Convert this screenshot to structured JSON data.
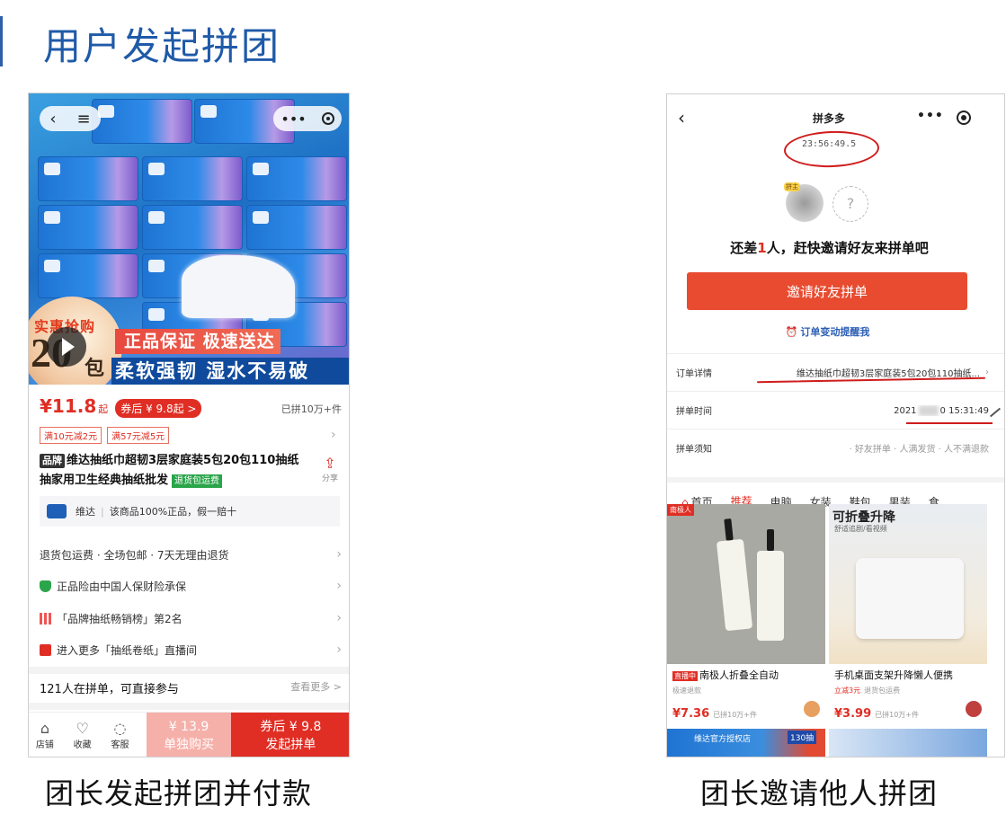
{
  "slide": {
    "title": "用户发起拼团",
    "caption_left": "团长发起拼团并付款",
    "caption_right": "团长邀请他人拼团"
  },
  "left_phone": {
    "image_badge": {
      "top": "实惠抢购",
      "number": "20",
      "unit": "包"
    },
    "banner_red": "正品保证 极速送达",
    "banner_blue": "柔软强韧 湿水不易破",
    "price": "¥11.8",
    "price_suffix": "起",
    "coupon": "券后 ¥ 9.8起 >",
    "sold": "已拼10万+件",
    "discounts": [
      "满10元减2元",
      "满57元减5元"
    ],
    "brand_tag": "品牌",
    "title": "维达抽纸巾超韧3层家庭装5包20包110抽纸抽家用卫生经典抽纸批发",
    "return_tag": "退货包运费",
    "share": "分享",
    "brand_name": "维达",
    "brand_note": "该商品100%正品，假一赔十",
    "services": [
      "退货包运费 · 全场包邮 · 7天无理由退货",
      "正品险由中国人保财险承保",
      "「品牌抽纸畅销榜」第2名",
      "进入更多「抽纸卷纸」直播间"
    ],
    "group_text": "121人在拼单，可直接参与",
    "group_more": "查看更多 >",
    "bottom": {
      "store": "店铺",
      "favorite": "收藏",
      "service": "客服",
      "alone_price": "¥ 13.9",
      "alone_label": "单独购买",
      "group_price": "券后 ¥ 9.8",
      "group_label": "发起拼单"
    }
  },
  "right_phone": {
    "title": "拼多多",
    "timer": "23:56:49.5",
    "leader_tag": "拼主",
    "empty_slot": "?",
    "invite_prefix": "还差",
    "invite_count": "1",
    "invite_suffix": "人，赶快邀请好友来拼单吧",
    "invite_button": "邀请好友拼单",
    "remind": "订单变动提醒我",
    "order_detail_label": "订单详情",
    "order_detail_value": "维达抽纸巾超韧3层家庭装5包20包110抽纸...",
    "order_time_label": "拼单时间",
    "order_time_prefix": "2021",
    "order_time_suffix": "0 15:31:49",
    "notice_label": "拼单须知",
    "notice_value": "· 好友拼单 · 人满发货 · 人不满退款",
    "tabs": [
      "首页",
      "推荐",
      "电脑",
      "女装",
      "鞋包",
      "男装",
      "食"
    ],
    "active_tab": "推荐",
    "products": [
      {
        "corner": "南极人",
        "live_tag": "直播中",
        "name": "南极人折叠全自动",
        "sub": "极速退款",
        "price": "¥7.36",
        "sold": "已拼10万+件"
      },
      {
        "headline": "可折叠升降",
        "subhead": "舒适追剧/看视频",
        "name": "手机桌面支架升降懒人便携",
        "sub_red": "立减3元",
        "sub": "退货包运费",
        "price": "¥3.99",
        "sold": "已拼10万+件"
      }
    ],
    "next_row": {
      "label": "维达官方授权店",
      "box": "130抽"
    }
  },
  "colors": {
    "slide_title": "#1f5aa8",
    "pdd_red": "#e02e24",
    "annotation_red": "#d01c1c"
  }
}
